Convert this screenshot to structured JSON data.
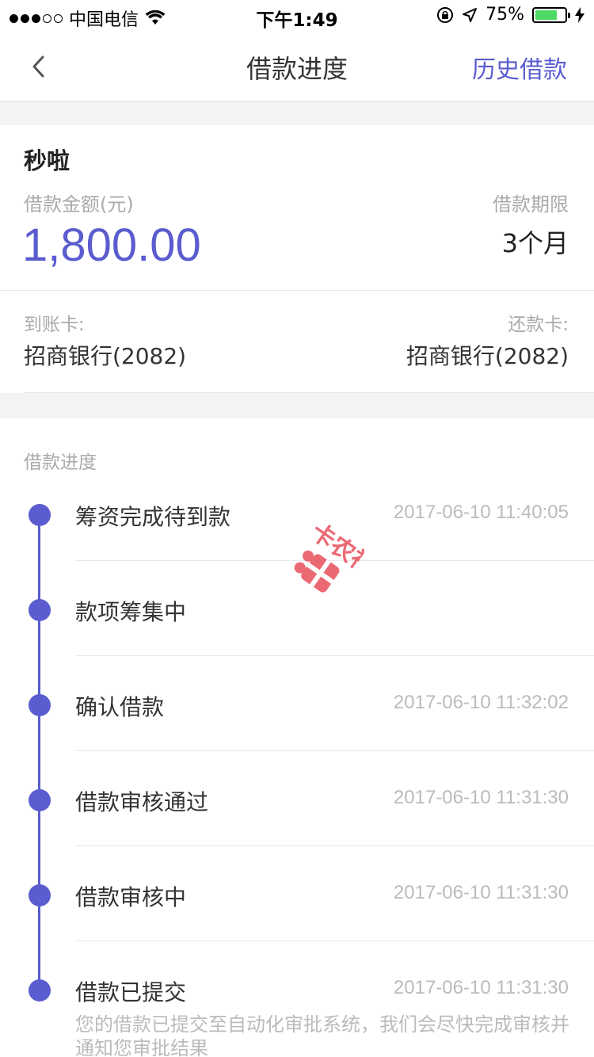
{
  "status_bar": {
    "carrier": "中国电信",
    "time": "下午1:49",
    "battery": "75%"
  },
  "nav": {
    "title": "借款进度",
    "history": "历史借款"
  },
  "loan": {
    "product": "秒啦",
    "amount_label": "借款金额(元)",
    "amount": "1,800.00",
    "term_label": "借款期限",
    "term_value": "3个月",
    "receive_label": "到账卡:",
    "receive_card": "招商银行(2082)",
    "repay_label": "还款卡:",
    "repay_card": "招商银行(2082)"
  },
  "progress": {
    "label": "借款进度",
    "steps": [
      {
        "title": "筹资完成待到款",
        "time": "2017-06-10 11:40:05"
      },
      {
        "title": "款项筹集中",
        "time": ""
      },
      {
        "title": "确认借款",
        "time": "2017-06-10 11:32:02"
      },
      {
        "title": "借款审核通过",
        "time": "2017-06-10 11:31:30"
      },
      {
        "title": "借款审核中",
        "time": "2017-06-10 11:31:30"
      },
      {
        "title": "借款已提交",
        "time": "2017-06-10 11:31:30",
        "desc": "您的借款已提交至自动化审批系统，我们会尽快完成审核并通知您审批结果"
      }
    ]
  },
  "watermark": {
    "text": "卡农社区"
  },
  "colors": {
    "accent": "#5a5ccf",
    "watermark": "#e8505b"
  }
}
